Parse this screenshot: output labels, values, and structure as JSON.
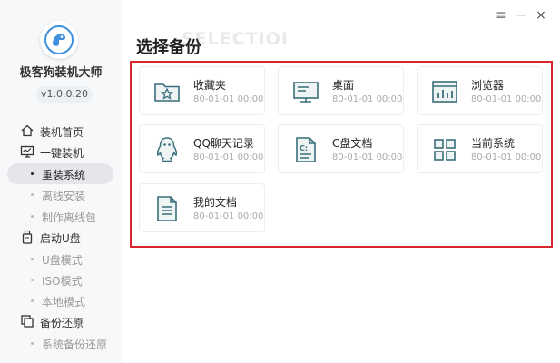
{
  "app": {
    "name": "极客狗装机大师",
    "version": "v1.0.0.20"
  },
  "window_controls": {
    "menu": "≡",
    "minimize": "−",
    "close": "×"
  },
  "sidebar": {
    "items": [
      {
        "label": "装机首页",
        "type": "main",
        "icon": "home-icon"
      },
      {
        "label": "一键装机",
        "type": "main",
        "icon": "monitor-icon"
      },
      {
        "label": "重装系统",
        "type": "sub",
        "active": true
      },
      {
        "label": "离线安装",
        "type": "sub"
      },
      {
        "label": "制作离线包",
        "type": "sub"
      },
      {
        "label": "启动U盘",
        "type": "main",
        "icon": "usb-icon"
      },
      {
        "label": "U盘模式",
        "type": "sub"
      },
      {
        "label": "ISO模式",
        "type": "sub"
      },
      {
        "label": "本地模式",
        "type": "sub"
      },
      {
        "label": "备份还原",
        "type": "main",
        "icon": "backup-icon"
      },
      {
        "label": "系统备份还原",
        "type": "sub"
      }
    ]
  },
  "main": {
    "watermark": "SELECTIOI",
    "title": "选择备份",
    "items": [
      {
        "name": "收藏夹",
        "date": "80-01-01 00:00",
        "icon": "favorites-folder-icon"
      },
      {
        "name": "桌面",
        "date": "80-01-01 00:00",
        "icon": "desktop-icon"
      },
      {
        "name": "浏览器",
        "date": "80-01-01 00:00",
        "icon": "browser-icon"
      },
      {
        "name": "QQ聊天记录",
        "date": "80-01-01 00:00",
        "icon": "qq-penguin-icon"
      },
      {
        "name": "C盘文档",
        "date": "80-01-01 00:00",
        "icon": "c-drive-document-icon"
      },
      {
        "name": "当前系统",
        "date": "80-01-01 00:00",
        "icon": "system-grid-icon"
      },
      {
        "name": "我的文档",
        "date": "80-01-01 00:00",
        "icon": "document-icon"
      }
    ]
  },
  "colors": {
    "highlight_border": "#d9252f",
    "icon_accent": "#3a6e7a",
    "logo_accent": "#3f8fe0"
  }
}
